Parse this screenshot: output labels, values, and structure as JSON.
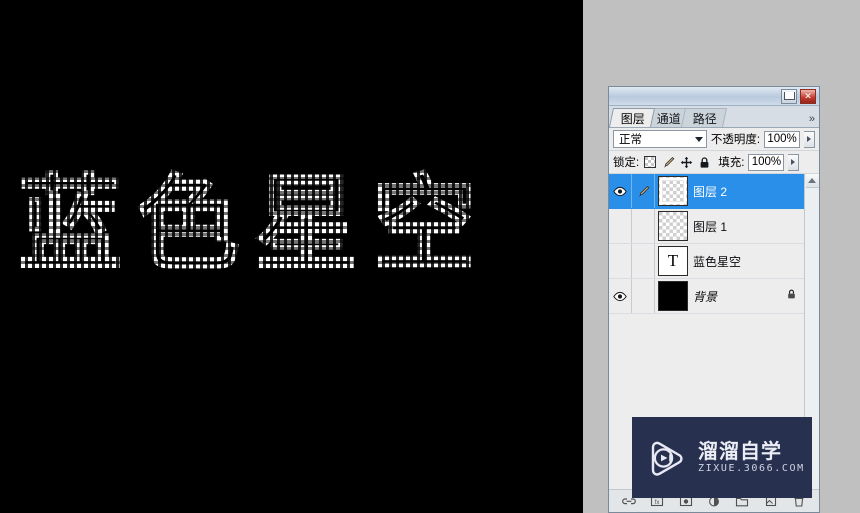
{
  "canvas": {
    "document_text": "蓝色星空",
    "background_color": "#000000",
    "selection_style": "marching-ants"
  },
  "desktop": {
    "background_color": "#c0c0c0"
  },
  "panel": {
    "titlebar": {
      "minimize_label": "",
      "close_label": "✕"
    },
    "tabs": [
      {
        "label": "图层",
        "name": "tab-layers",
        "active": true
      },
      {
        "label": "通道",
        "name": "tab-channels",
        "active": false
      },
      {
        "label": "路径",
        "name": "tab-paths",
        "active": false
      }
    ],
    "overflow_label": "»",
    "blend_mode": {
      "value": "正常"
    },
    "opacity": {
      "label": "不透明度:",
      "value": "100%"
    },
    "lock": {
      "label": "锁定:",
      "icons": [
        "lock-transparent-pixels",
        "lock-image-pixels",
        "lock-position",
        "lock-all"
      ]
    },
    "fill": {
      "label": "填充:",
      "value": "100%"
    },
    "layers": [
      {
        "name": "图层 2",
        "visible": true,
        "selected": true,
        "thumb_type": "transparent",
        "has_brush_icon": true,
        "locked": false
      },
      {
        "name": "图层 1",
        "visible": false,
        "selected": false,
        "thumb_type": "transparent",
        "has_brush_icon": false,
        "locked": false
      },
      {
        "name": "蓝色星空",
        "visible": false,
        "selected": false,
        "thumb_type": "text",
        "thumb_glyph": "T",
        "has_brush_icon": false,
        "locked": false
      },
      {
        "name": "背景",
        "visible": true,
        "selected": false,
        "thumb_type": "black",
        "has_brush_icon": false,
        "locked": true
      }
    ],
    "accent_color": "#2a8fe8",
    "background_color": "#ededed"
  },
  "watermark": {
    "brand": "溜溜自学",
    "url": "ZIXUE.3066.COM",
    "background_color": "#27304e"
  }
}
